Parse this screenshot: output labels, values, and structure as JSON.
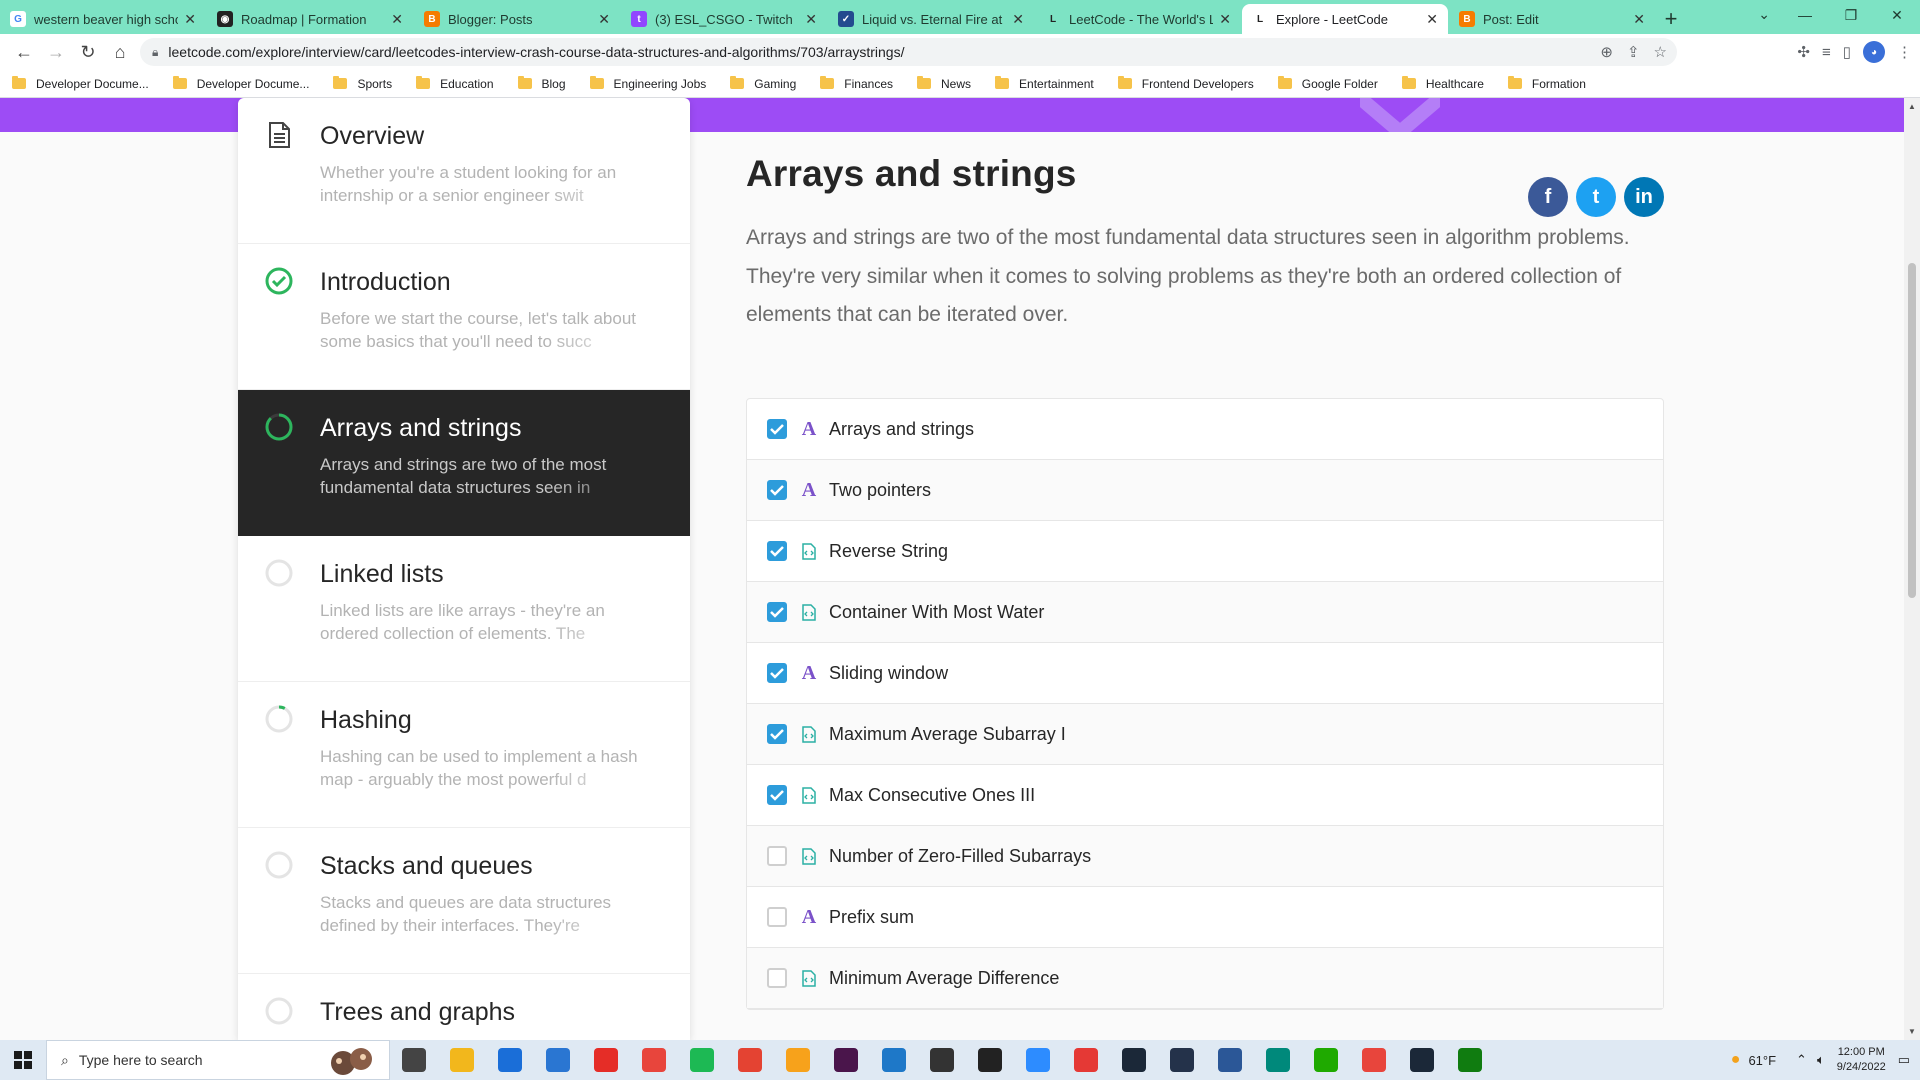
{
  "browser": {
    "tabs": [
      {
        "title": "western beaver high schoo",
        "fav": "G",
        "favcolor": "#ffffff",
        "favtext": "#4285f4"
      },
      {
        "title": "Roadmap | Formation",
        "fav": "◉",
        "favcolor": "#222222",
        "favtext": "#ffffff"
      },
      {
        "title": "Blogger: Posts",
        "fav": "B",
        "favcolor": "#f57c00",
        "favtext": "#ffffff"
      },
      {
        "title": "(3) ESL_CSGO - Twitch",
        "fav": "t",
        "favcolor": "#9146ff",
        "favtext": "#ffffff"
      },
      {
        "title": "Liquid vs. Eternal Fire at ES",
        "fav": "✓",
        "favcolor": "#234b8f",
        "favtext": "#ffffff"
      },
      {
        "title": "LeetCode - The World's Le",
        "fav": "L",
        "favcolor": "#7de3c4",
        "favtext": "#222222"
      },
      {
        "title": "Explore - LeetCode",
        "fav": "L",
        "favcolor": "#ffffff",
        "favtext": "#222222",
        "active": true
      },
      {
        "title": "Post: Edit",
        "fav": "B",
        "favcolor": "#f57c00",
        "favtext": "#ffffff"
      }
    ],
    "url": "leetcode.com/explore/interview/card/leetcodes-interview-crash-course-data-structures-and-algorithms/703/arraystrings/",
    "bookmarks": [
      "Developer Docume...",
      "Developer Docume...",
      "Sports",
      "Education",
      "Blog",
      "Engineering Jobs",
      "Gaming",
      "Finances",
      "News",
      "Entertainment",
      "Frontend Developers",
      "Google Folder",
      "Healthcare",
      "Formation"
    ]
  },
  "sidebar": {
    "chapters": [
      {
        "title": "Overview",
        "desc": "Whether you're a student looking for an internship or a senior engineer swit",
        "status": "doc"
      },
      {
        "title": "Introduction",
        "desc": "Before we start the course, let's talk about some basics that you'll need to succ",
        "status": "complete"
      },
      {
        "title": "Arrays and strings",
        "desc": "Arrays and strings are two of the most fundamental data structures seen in",
        "status": "mostly",
        "active": true
      },
      {
        "title": "Linked lists",
        "desc": "Linked lists are like arrays - they're an ordered collection of elements. The",
        "status": "empty"
      },
      {
        "title": "Hashing",
        "desc": "Hashing can be used to implement a hash map - arguably the most powerful d",
        "status": "started"
      },
      {
        "title": "Stacks and queues",
        "desc": "Stacks and queues are data structures defined by their interfaces. They're",
        "status": "empty"
      },
      {
        "title": "Trees and graphs",
        "desc": "",
        "status": "empty"
      }
    ]
  },
  "main": {
    "title": "Arrays and strings",
    "intro": "Arrays and strings are two of the most fundamental data structures seen in algorithm problems. They're very similar when it comes to solving problems as they're both an ordered collection of elements that can be iterated over.",
    "social": [
      {
        "name": "facebook",
        "glyph": "f",
        "color": "#3b5998"
      },
      {
        "name": "twitter",
        "glyph": "t",
        "color": "#1da1f2"
      },
      {
        "name": "linkedin",
        "glyph": "in",
        "color": "#0077b5"
      }
    ],
    "items": [
      {
        "label": "Arrays and strings",
        "type": "article",
        "done": true
      },
      {
        "label": "Two pointers",
        "type": "article",
        "done": true
      },
      {
        "label": "Reverse String",
        "type": "problem",
        "done": true
      },
      {
        "label": "Container With Most Water",
        "type": "problem",
        "done": true
      },
      {
        "label": "Sliding window",
        "type": "article",
        "done": true
      },
      {
        "label": "Maximum Average Subarray I",
        "type": "problem",
        "done": true
      },
      {
        "label": "Max Consecutive Ones III",
        "type": "problem",
        "done": true
      },
      {
        "label": "Number of Zero-Filled Subarrays",
        "type": "problem",
        "done": false
      },
      {
        "label": "Prefix sum",
        "type": "article",
        "done": false
      },
      {
        "label": "Minimum Average Difference",
        "type": "problem",
        "done": false
      }
    ]
  },
  "taskbar": {
    "search_placeholder": "Type here to search",
    "weather": "61°F",
    "time": "12:00 PM",
    "date": "9/24/2022"
  }
}
